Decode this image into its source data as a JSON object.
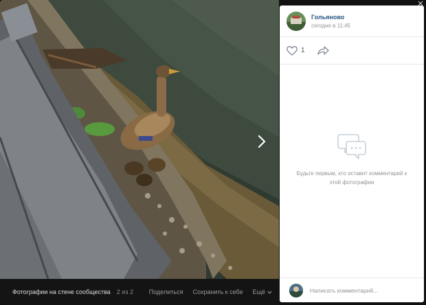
{
  "author": {
    "name": "Гольяново",
    "time": "сегодня в 11:45"
  },
  "likes": {
    "count": "1"
  },
  "empty_state": {
    "text": "Будьте первым, кто оставит комментарий к этой фотографии"
  },
  "comment": {
    "placeholder": "Написать комментарий..."
  },
  "bottom_bar": {
    "album_title": "Фотографии на стене сообщества",
    "counter": "2 из 2",
    "share": "Поделиться",
    "save": "Сохранить к себе",
    "more": "Ещё"
  },
  "icons": {
    "next": "chevron-right-icon",
    "like": "heart-icon",
    "share": "share-arrow-icon",
    "comments": "comments-icon",
    "more": "chevron-down-icon",
    "close": "close-icon"
  },
  "colors": {
    "link": "#2a5885",
    "muted": "#939393",
    "photo_bar": "#141414"
  }
}
